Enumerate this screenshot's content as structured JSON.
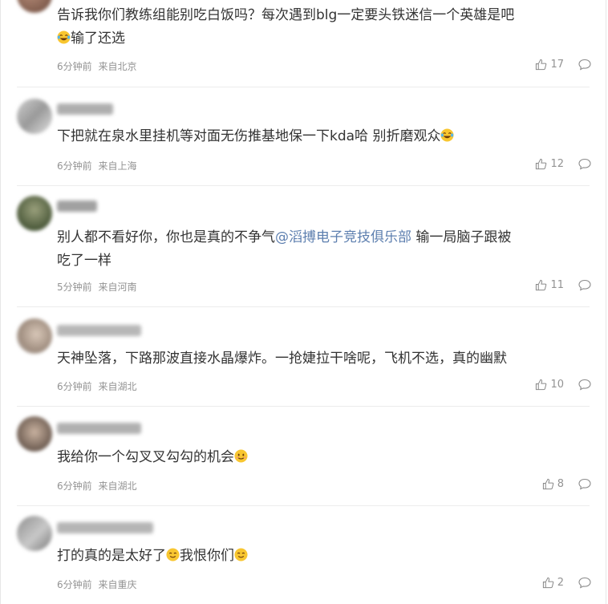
{
  "comments": [
    {
      "text": "告诉我你们教练组能别吃白饭吗？每次遇到blg一定要头铁迷信一个英雄是吧",
      "text2": "输了还选",
      "emoji": "laughing-tears",
      "time": "6分钟前",
      "location": "来自北京",
      "likes": "17"
    },
    {
      "text": "下把就在泉水里挂机等对面无伤推基地保一下kda哈 别折磨观众",
      "emoji": "laughing-tears",
      "time": "6分钟前",
      "location": "来自上海",
      "likes": "12"
    },
    {
      "text": "别人都不看好你，你也是真的不争气",
      "mention": "@滔搏电子竞技俱乐部",
      "text2": " 输一局脑子跟被",
      "text3": "吃了一样",
      "time": "5分钟前",
      "location": "来自河南",
      "likes": "11"
    },
    {
      "text": "天神坠落，下路那波直接水晶爆炸。一抢婕拉干啥呢，飞机不选，真的幽默",
      "time": "6分钟前",
      "location": "来自湖北",
      "likes": "10"
    },
    {
      "text": "我给你一个勾叉叉勾勾的机会",
      "emoji": "blush",
      "time": "6分钟前",
      "location": "来自湖北",
      "likes": "8"
    },
    {
      "text": "打的真的是太好了",
      "emoji": "smile",
      "text2": "我恨你们",
      "emoji2": "smile",
      "time": "6分钟前",
      "location": "来自重庆",
      "likes": "2"
    }
  ]
}
